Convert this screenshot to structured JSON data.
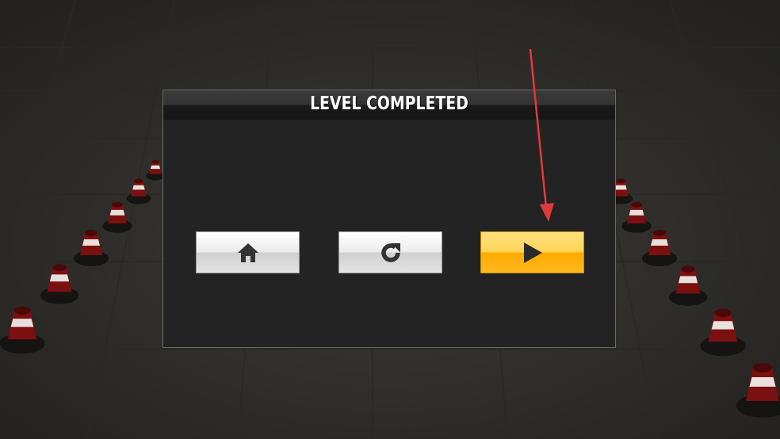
{
  "dialog": {
    "title": "LEVEL COMPLETED"
  },
  "buttons": [
    {
      "name": "home",
      "icon": "home-icon"
    },
    {
      "name": "replay",
      "icon": "replay-icon"
    },
    {
      "name": "next",
      "icon": "play-icon"
    }
  ],
  "colors": {
    "background": "#35342f",
    "dialog": "#232323",
    "button_gray": "#e4e4e4",
    "button_next": "#ffb820",
    "arrow": "#e23a3a",
    "cone_red": "#7a1010"
  }
}
